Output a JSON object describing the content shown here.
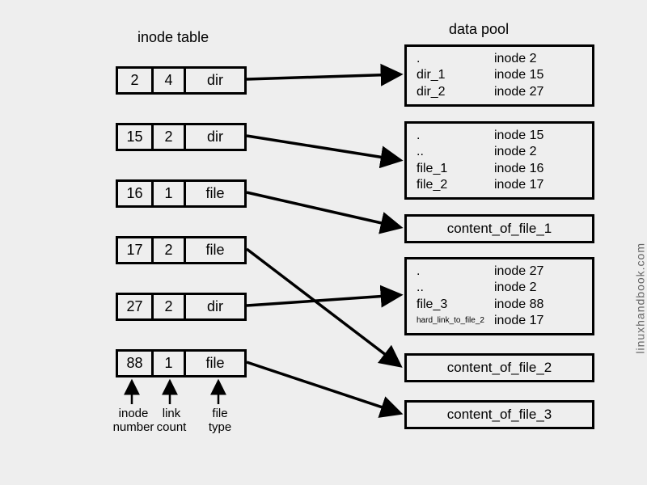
{
  "titles": {
    "inode_table": "inode table",
    "data_pool": "data pool"
  },
  "watermark": "linuxhandbook.com",
  "inode_rows": [
    {
      "inode": "2",
      "links": "4",
      "type": "dir"
    },
    {
      "inode": "15",
      "links": "2",
      "type": "dir"
    },
    {
      "inode": "16",
      "links": "1",
      "type": "file"
    },
    {
      "inode": "17",
      "links": "2",
      "type": "file"
    },
    {
      "inode": "27",
      "links": "2",
      "type": "dir"
    },
    {
      "inode": "88",
      "links": "1",
      "type": "file"
    }
  ],
  "annotations": {
    "inode_number": "inode\nnumber",
    "link_count": "link\ncount",
    "file_type": "file\ntype"
  },
  "data_pool_boxes": [
    {
      "kind": "dir",
      "entries": [
        {
          "name": ".",
          "inode": "inode 2"
        },
        {
          "name": "dir_1",
          "inode": "inode 15"
        },
        {
          "name": "dir_2",
          "inode": "inode 27"
        }
      ]
    },
    {
      "kind": "dir",
      "entries": [
        {
          "name": ".",
          "inode": "inode 15"
        },
        {
          "name": "..",
          "inode": "inode 2"
        },
        {
          "name": "file_1",
          "inode": "inode 16"
        },
        {
          "name": "file_2",
          "inode": "inode 17"
        }
      ]
    },
    {
      "kind": "content",
      "text": "content_of_file_1"
    },
    {
      "kind": "dir",
      "entries": [
        {
          "name": ".",
          "inode": "inode 27"
        },
        {
          "name": "..",
          "inode": "inode 2"
        },
        {
          "name": "file_3",
          "inode": "inode 88"
        },
        {
          "name": "hard_link_to_file_2",
          "small": true,
          "inode": "inode 17"
        }
      ]
    },
    {
      "kind": "content",
      "text": "content_of_file_2"
    },
    {
      "kind": "content",
      "text": "content_of_file_3"
    }
  ]
}
